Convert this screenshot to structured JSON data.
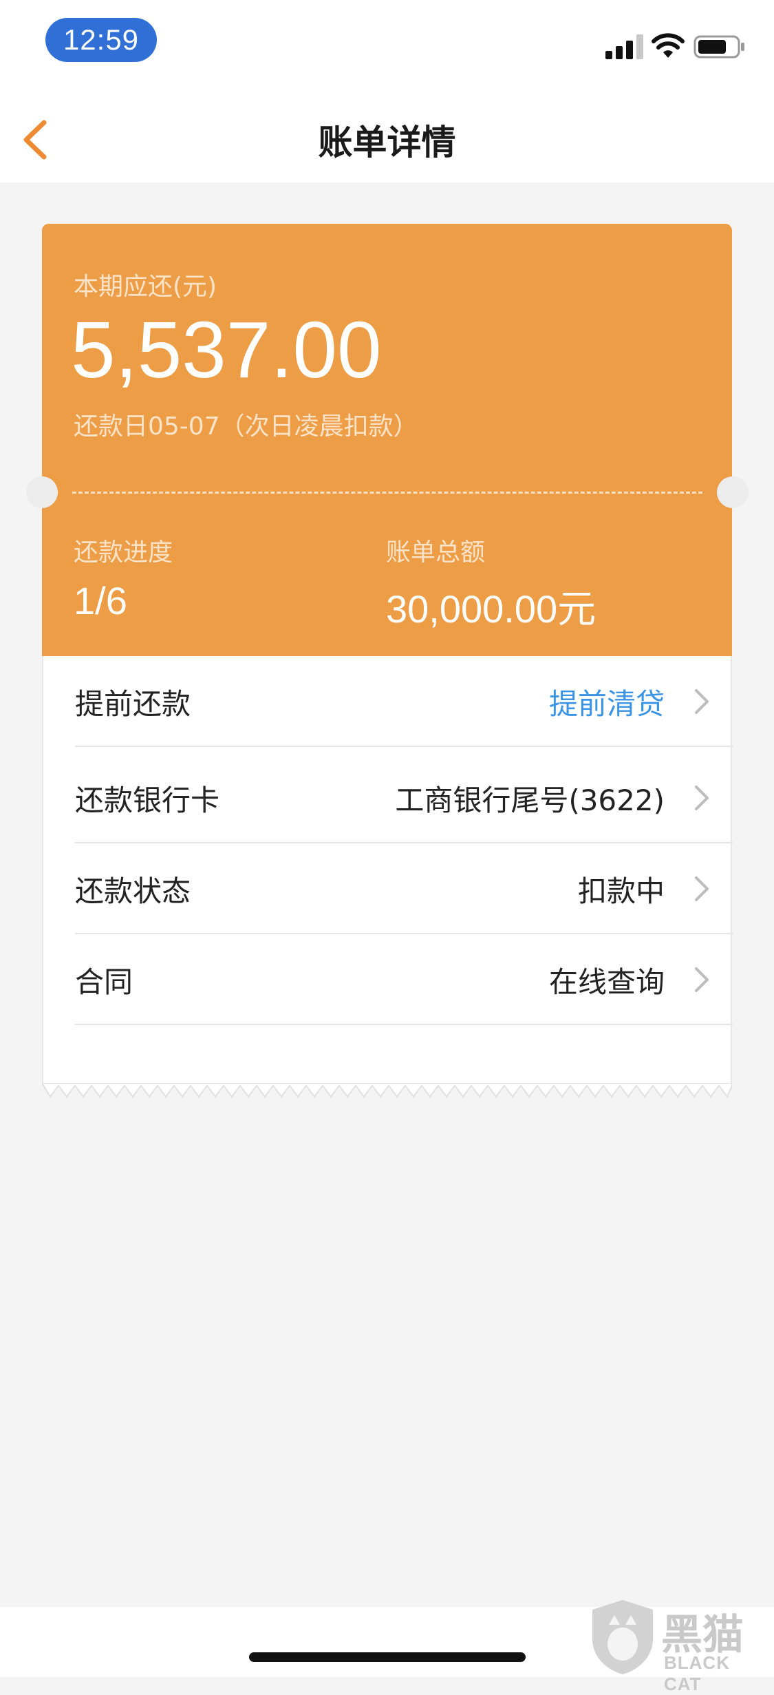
{
  "status_bar": {
    "time": "12:59"
  },
  "nav": {
    "title": "账单详情",
    "back_icon": "chevron-left-icon"
  },
  "bill": {
    "due_label": "本期应还(元)",
    "due_amount": "5,537.00",
    "due_date": "还款日05-07（次日凌晨扣款）",
    "progress_label": "还款进度",
    "progress_value": "1/6",
    "total_label": "账单总额",
    "total_value": "30,000.00元"
  },
  "rows": [
    {
      "label": "提前还款",
      "value": "提前清贷"
    },
    {
      "label": "还款银行卡",
      "value": "工商银行尾号(3622)"
    },
    {
      "label": "还款状态",
      "value": "扣款中"
    },
    {
      "label": "合同",
      "value": "在线查询"
    }
  ],
  "watermark": {
    "text": "黑猫",
    "sub": "BLACK CAT"
  },
  "colors": {
    "accent_orange": "#ee9d47",
    "link_blue": "#3a94e6",
    "time_pill": "#2f6fd6",
    "background": "#f4f4f4"
  }
}
